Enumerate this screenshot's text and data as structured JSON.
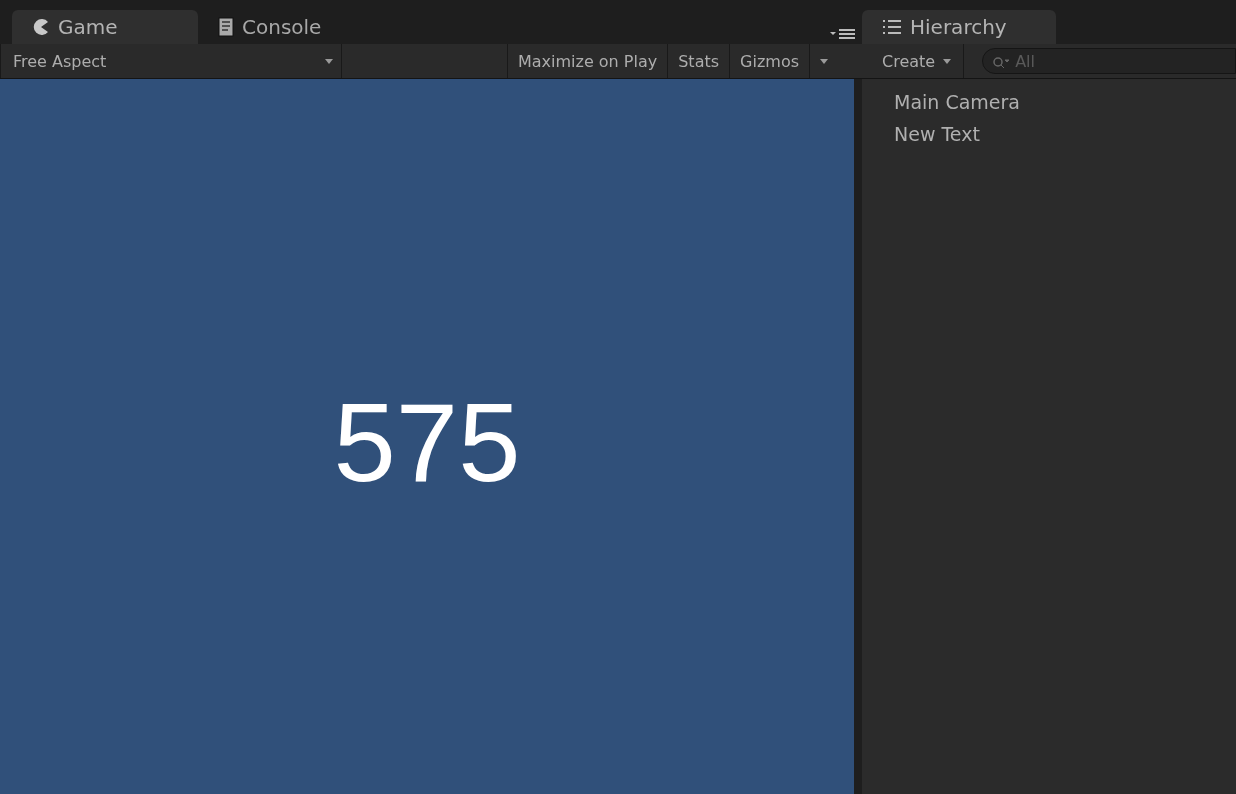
{
  "game_panel": {
    "tabs": [
      {
        "label": "Game",
        "selected": true
      },
      {
        "label": "Console",
        "selected": false
      }
    ],
    "toolbar": {
      "aspect": "Free Aspect",
      "buttons": [
        "Maximize on Play",
        "Stats",
        "Gizmos"
      ]
    },
    "view": {
      "text": "575"
    }
  },
  "hierarchy_panel": {
    "tabs": [
      {
        "label": "Hierarchy",
        "selected": true
      }
    ],
    "create_button": "Create",
    "search": {
      "placeholder": "All"
    },
    "items": [
      {
        "label": "Main Camera"
      },
      {
        "label": "New Text"
      }
    ]
  }
}
